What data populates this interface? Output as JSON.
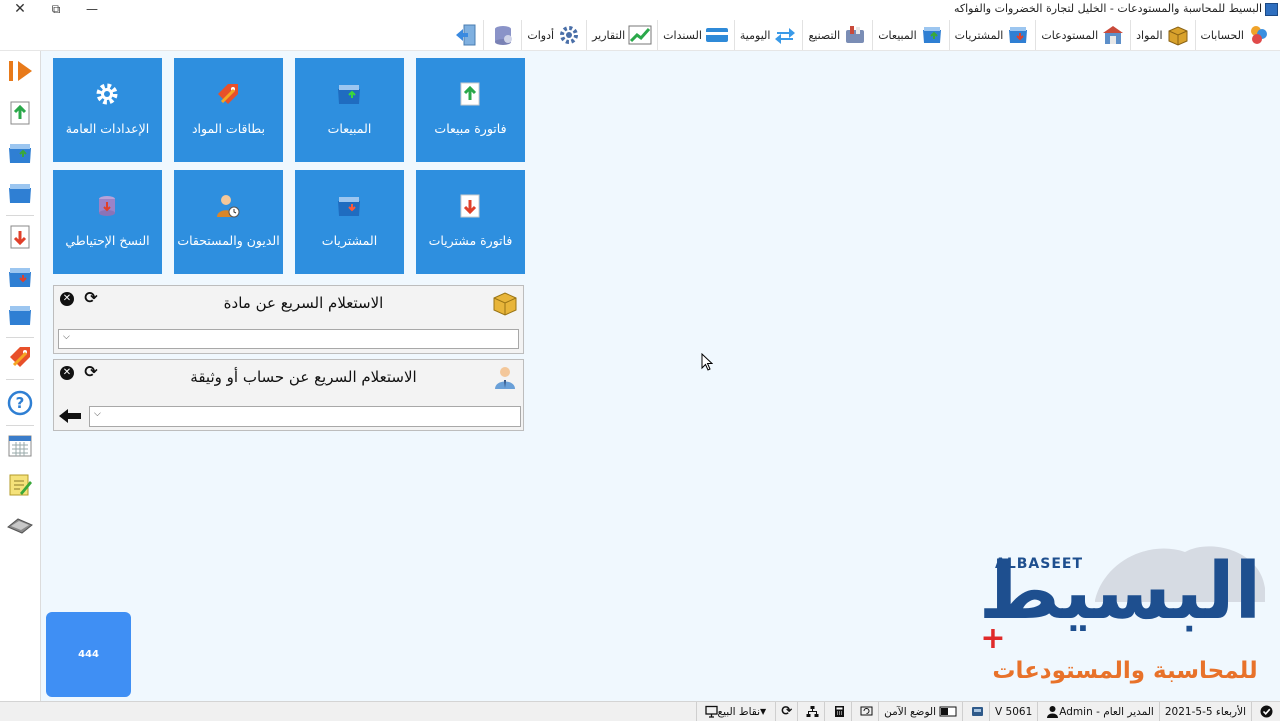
{
  "window": {
    "title": "البسيط للمحاسبة والمستودعات - الخليل لتجارة الخضروات والفواكه",
    "close": "✕",
    "restore": "⧉",
    "minimize": "—"
  },
  "menu": [
    {
      "label": "الحسابات",
      "icon": "accounts-icon"
    },
    {
      "label": "المواد",
      "icon": "materials-box-icon"
    },
    {
      "label": "المستودعات",
      "icon": "warehouse-icon"
    },
    {
      "label": "المشتريات",
      "icon": "purchases-icon"
    },
    {
      "label": "المبيعات",
      "icon": "sales-icon"
    },
    {
      "label": "التصنيع",
      "icon": "manufacturing-icon"
    },
    {
      "label": "اليومية",
      "icon": "journal-arrows-icon"
    },
    {
      "label": "السندات",
      "icon": "vouchers-card-icon"
    },
    {
      "label": "التقارير",
      "icon": "reports-chart-icon"
    },
    {
      "label": "أدوات",
      "icon": "tools-gear-icon"
    },
    {
      "label": "",
      "icon": "database-settings-icon"
    },
    {
      "label": "",
      "icon": "exit-door-icon"
    }
  ],
  "tiles": [
    {
      "label": "فاتورة مبيعات",
      "icon": "sales-invoice-icon"
    },
    {
      "label": "المبيعات",
      "icon": "sales-icon"
    },
    {
      "label": "بطاقات المواد",
      "icon": "material-cards-tag-icon"
    },
    {
      "label": "الإعدادات العامة",
      "icon": "settings-gear-icon"
    },
    {
      "label": "فاتورة مشتريات",
      "icon": "purchase-invoice-icon"
    },
    {
      "label": "المشتريات",
      "icon": "purchases-icon"
    },
    {
      "label": "الديون والمستحقات",
      "icon": "debts-person-icon"
    },
    {
      "label": "النسخ الإحتياطي",
      "icon": "backup-database-icon"
    }
  ],
  "quick_query_item": {
    "title": "الاستعلام السريع عن مادة",
    "value": ""
  },
  "quick_query_account": {
    "title": "الاستعلام السريع عن حساب أو وثيقة",
    "value": ""
  },
  "logo": {
    "latin": "ALBASEET",
    "arabic_big": "البسيط",
    "plus": "+",
    "subtitle": "للمحاسبة والمستودعات"
  },
  "box": {
    "value": "444"
  },
  "status": {
    "date": "الأربعاء 5-5-2021",
    "user": "المدير العام - Admin",
    "version": "V 5061",
    "safe_mode": "الوضع الآمن",
    "pos": "نقاط البيع"
  },
  "colors": {
    "tile": "#2e8fdf",
    "box": "#3f8ff4",
    "logo_blue": "#1e4f8f",
    "logo_orange": "#e8722a",
    "background": "#f0f8fe"
  }
}
